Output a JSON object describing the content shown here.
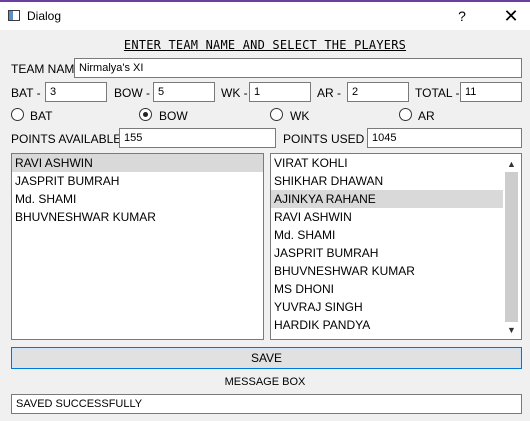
{
  "window": {
    "title": "Dialog",
    "help": "?",
    "close": "✕",
    "accent": "#6b3fa0"
  },
  "heading": "ENTER TEAM NAME AND SELECT THE PLAYERS",
  "team": {
    "label": "TEAM NAME",
    "value": "Nirmalya's XI"
  },
  "counts": {
    "bat_label": "BAT -",
    "bat_value": "3",
    "bow_label": "BOW -",
    "bow_value": "5",
    "wk_label": "WK -",
    "wk_value": "1",
    "ar_label": "AR -",
    "ar_value": "2",
    "total_label": "TOTAL -",
    "total_value": "11"
  },
  "radios": [
    {
      "label": "BAT",
      "checked": false
    },
    {
      "label": "BOW",
      "checked": true
    },
    {
      "label": "WK",
      "checked": false
    },
    {
      "label": "AR",
      "checked": false
    }
  ],
  "points": {
    "available_label": "POINTS AVAILABLE -",
    "available_value": "155",
    "used_label": "POINTS USED  -",
    "used_value": "1045"
  },
  "selected_list": [
    "RAVI ASHWIN",
    "JASPRIT BUMRAH",
    "Md. SHAMI",
    "BHUVNESHWAR KUMAR"
  ],
  "selected_highlight": "RAVI ASHWIN",
  "available_list": [
    "VIRAT KOHLI",
    "SHIKHAR DHAWAN",
    "AJINKYA RAHANE",
    "RAVI ASHWIN",
    "Md. SHAMI",
    "JASPRIT BUMRAH",
    "BHUVNESHWAR KUMAR",
    "MS DHONI",
    "YUVRAJ SINGH",
    "HARDIK PANDYA"
  ],
  "available_highlight": "AJINKYA RAHANE",
  "scroll": {
    "up": "▲",
    "down": "▼"
  },
  "save_label": "SAVE",
  "message": {
    "label": "MESSAGE BOX",
    "value": "SAVED SUCCESSFULLY"
  },
  "colors": {
    "focus_border": "#0078d7",
    "selection": "#d9d9d9"
  }
}
